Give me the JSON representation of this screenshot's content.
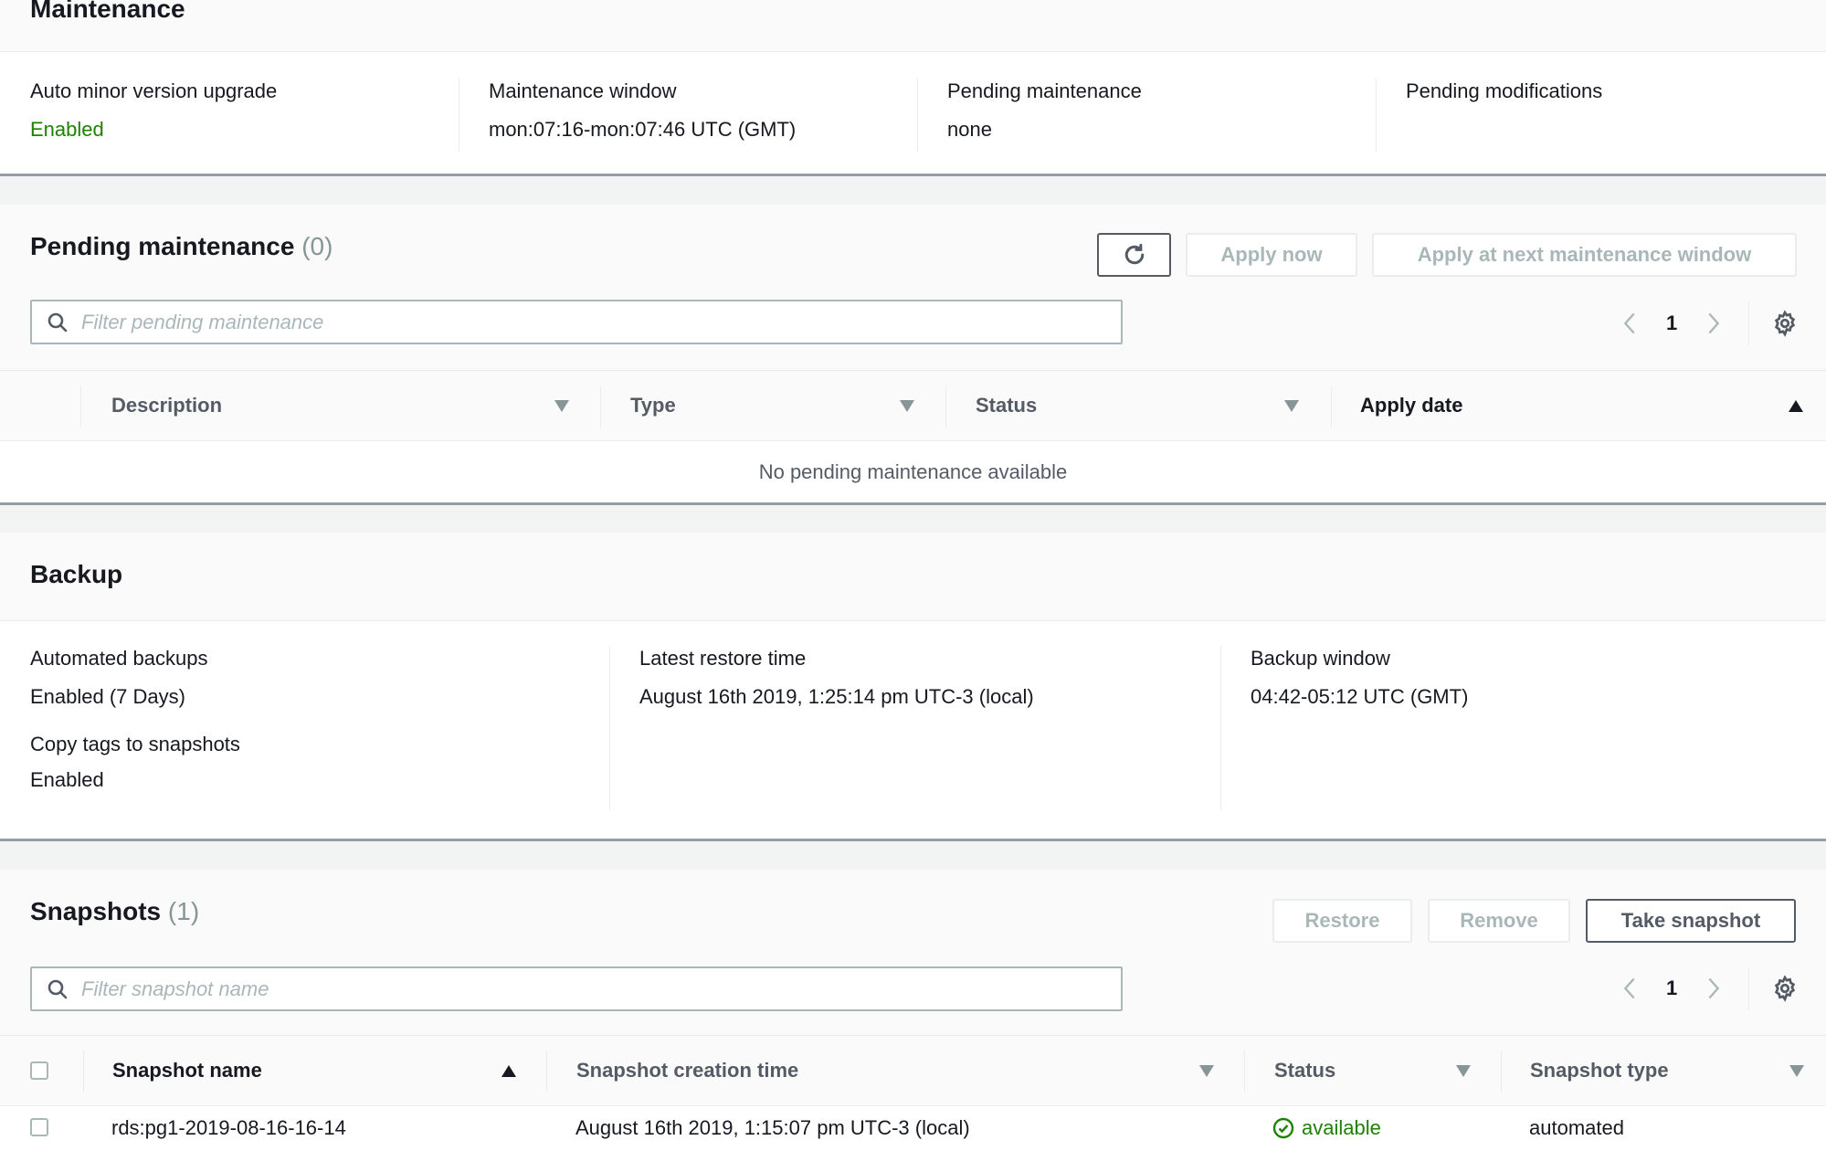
{
  "maintenance": {
    "title": "Maintenance",
    "fields": [
      {
        "label": "Auto minor version upgrade",
        "value": "Enabled",
        "status": "success"
      },
      {
        "label": "Maintenance window",
        "value": "mon:07:16-mon:07:46 UTC (GMT)"
      },
      {
        "label": "Pending maintenance",
        "value": "none"
      },
      {
        "label": "Pending modifications",
        "value": ""
      }
    ]
  },
  "pending": {
    "title": "Pending maintenance",
    "count": "(0)",
    "refresh_icon": "refresh-icon",
    "apply_now_label": "Apply now",
    "apply_next_label": "Apply at next maintenance window",
    "filter_placeholder": "Filter pending maintenance",
    "filter_value": "",
    "page": "1",
    "columns": [
      {
        "label": "Description",
        "sort": "none"
      },
      {
        "label": "Type",
        "sort": "none"
      },
      {
        "label": "Status",
        "sort": "none"
      },
      {
        "label": "Apply date",
        "sort": "ascending"
      }
    ],
    "empty_message": "No pending maintenance available"
  },
  "backup": {
    "title": "Backup",
    "fields": [
      {
        "label": "Automated backups",
        "value": "Enabled (7 Days)"
      },
      {
        "label": "Copy tags to snapshots",
        "value": "Enabled"
      },
      {
        "label": "Latest restore time",
        "value": "August 16th 2019, 1:25:14 pm UTC-3 (local)"
      },
      {
        "label": "Backup window",
        "value": "04:42-05:12 UTC (GMT)"
      }
    ]
  },
  "snapshots": {
    "title": "Snapshots",
    "count": "(1)",
    "restore_label": "Restore",
    "remove_label": "Remove",
    "take_snapshot_label": "Take snapshot",
    "filter_placeholder": "Filter snapshot name",
    "filter_value": "",
    "page": "1",
    "columns": [
      {
        "label": "Snapshot name",
        "sort": "ascending"
      },
      {
        "label": "Snapshot creation time",
        "sort": "none"
      },
      {
        "label": "Status",
        "sort": "none"
      },
      {
        "label": "Snapshot type",
        "sort": "none"
      }
    ],
    "rows": [
      {
        "name": "rds:pg1-2019-08-16-16-14",
        "created": "August 16th 2019, 1:15:07 pm UTC-3 (local)",
        "status": "available",
        "type": "automated",
        "selected": false
      }
    ]
  },
  "colors": {
    "success": "#1d8102",
    "disabled": "#aab7b8",
    "border_dark": "#545b64"
  }
}
